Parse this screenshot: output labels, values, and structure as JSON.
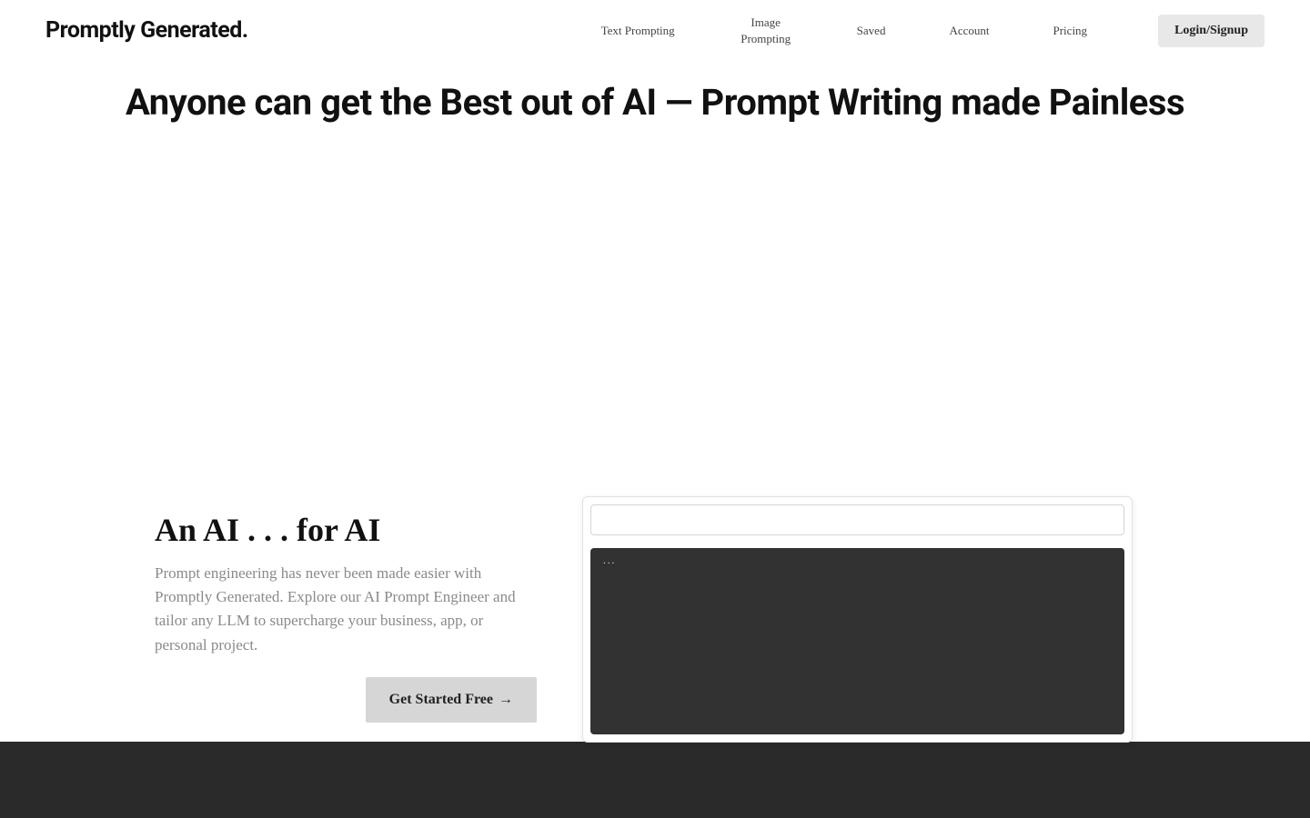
{
  "header": {
    "logo": "Promptly Generated.",
    "nav": {
      "text_prompting": "Text Prompting",
      "image_prompting": "Image Prompting",
      "saved": "Saved",
      "account": "Account",
      "pricing": "Pricing"
    },
    "login_btn": "Login/Signup"
  },
  "hero": {
    "title": "Anyone can get the Best out of AI —  Prompt Writing made Painless"
  },
  "section": {
    "heading": "An AI . . . for AI",
    "description": "Prompt engineering has never been made easier with Promptly Generated. Explore our AI Prompt Engineer and tailor any LLM to supercharge your business, app, or personal project.",
    "cta_label": "Get Started Free",
    "cta_arrow": "→"
  },
  "demo": {
    "input_value": "",
    "output_text": "..."
  }
}
